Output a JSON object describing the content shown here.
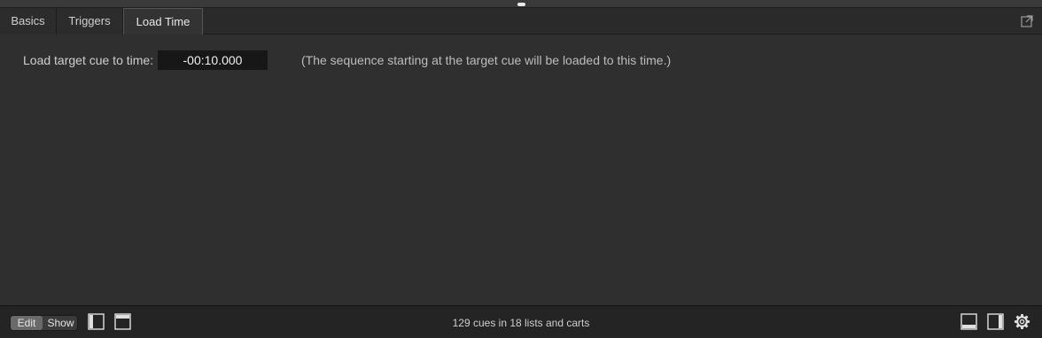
{
  "tabs": [
    {
      "label": "Basics"
    },
    {
      "label": "Triggers"
    },
    {
      "label": "Load Time"
    }
  ],
  "load_time": {
    "label": "Load target cue to time:",
    "value": "-00:10.000",
    "hint": "(The sequence starting at the target cue will be loaded to this time.)"
  },
  "footer": {
    "edit_label": "Edit",
    "show_label": "Show",
    "status": "129 cues in 18 lists and carts"
  },
  "icons": {
    "popout": "popout-icon",
    "left_sidebar": "left-sidebar-icon",
    "top_panel": "top-panel-icon",
    "bottom_panel": "bottom-panel-icon",
    "right_sidebar": "right-sidebar-icon",
    "settings": "gear-icon"
  }
}
